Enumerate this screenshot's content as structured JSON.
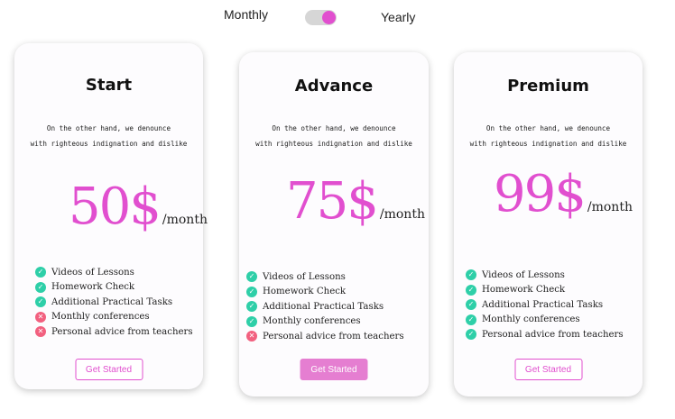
{
  "billing_toggle": {
    "left_label": "Monthly",
    "right_label": "Yearly",
    "selected": "Yearly"
  },
  "accent_color": "#e14fcf",
  "check_color": "#2ecfa8",
  "cross_color": "#f2607f",
  "plans": [
    {
      "name": "Start",
      "description_line1": "On the other hand, we denounce",
      "description_line2": "with righteous indignation and dislike",
      "price": "50$",
      "period": "/month",
      "features": [
        {
          "label": "Videos of Lessons",
          "icon": "check-icon",
          "included": true
        },
        {
          "label": "Homework Check",
          "icon": "check-icon",
          "included": true
        },
        {
          "label": "Additional Practical Tasks",
          "icon": "check-icon",
          "included": true
        },
        {
          "label": "Monthly conferences",
          "icon": "cross-icon",
          "included": false
        },
        {
          "label": "Personal advice from teachers",
          "icon": "cross-icon",
          "included": false
        }
      ],
      "cta_label": "Get Started"
    },
    {
      "name": "Advance",
      "description_line1": "On the other hand, we denounce",
      "description_line2": "with righteous indignation and dislike",
      "price": "75$",
      "period": "/month",
      "features": [
        {
          "label": "Videos of Lessons",
          "icon": "check-icon",
          "included": true
        },
        {
          "label": "Homework Check",
          "icon": "check-icon",
          "included": true
        },
        {
          "label": "Additional Practical Tasks",
          "icon": "check-icon",
          "included": true
        },
        {
          "label": "Monthly conferences",
          "icon": "check-icon",
          "included": true
        },
        {
          "label": "Personal advice from teachers",
          "icon": "cross-icon",
          "included": false
        }
      ],
      "cta_label": "Get Started"
    },
    {
      "name": "Premium",
      "description_line1": "On the other hand, we denounce",
      "description_line2": "with righteous indignation and dislike",
      "price": "99$",
      "period": "/month",
      "features": [
        {
          "label": "Videos of Lessons",
          "icon": "check-icon",
          "included": true
        },
        {
          "label": "Homework Check",
          "icon": "check-icon",
          "included": true
        },
        {
          "label": "Additional Practical Tasks",
          "icon": "check-icon",
          "included": true
        },
        {
          "label": "Monthly conferences",
          "icon": "check-icon",
          "included": true
        },
        {
          "label": "Personal advice from teachers",
          "icon": "check-icon",
          "included": true
        }
      ],
      "cta_label": "Get Started"
    }
  ]
}
